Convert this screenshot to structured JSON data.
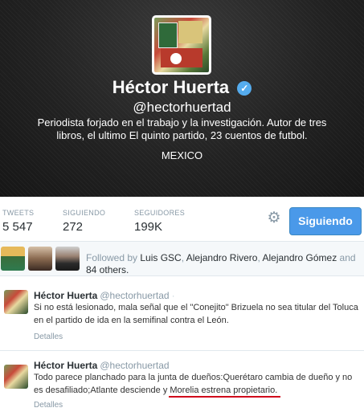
{
  "profile": {
    "name": "Héctor Huerta",
    "handle": "@hectorhuertad",
    "bio": "Periodista forjado en el trabajo y la investigación. Autor de tres libros, el ultimo El quinto partido, 23 cuentos de futbol.",
    "location": "MEXICO",
    "verified_glyph": "✓"
  },
  "stats": [
    {
      "label": "TWEETS",
      "value": "5 547"
    },
    {
      "label": "SIGUIENDO",
      "value": "272"
    },
    {
      "label": "SEGUIDORES",
      "value": "199K"
    }
  ],
  "actions": {
    "follow_label": "Siguiendo",
    "gear_glyph": "⚙"
  },
  "followed_by": {
    "prefix": "Followed by ",
    "names": [
      "Luis GSC",
      "Alejandro Rivero",
      "Alejandro Gómez"
    ],
    "sep1": ", ",
    "sep2": ", ",
    "sep3": " and ",
    "others": "84 others."
  },
  "tweets": [
    {
      "name": "Héctor Huerta",
      "handle": "@hectorhuertad",
      "dot": "·",
      "text": "Si no está lesionado, mala señal que el \"Conejito\" Brizuela no sea titular del Toluca en el partido de ida en la semifinal contra el León.",
      "details": "Detalles"
    },
    {
      "name": "Héctor Huerta",
      "handle": "@hectorhuertad",
      "dot": "·",
      "text": "Todo parece planchado para la junta de dueños:Querétaro cambia de dueño y no es desafiliado;Atlante desciende y Morelia estrena propietario.",
      "details": "Detalles"
    }
  ]
}
